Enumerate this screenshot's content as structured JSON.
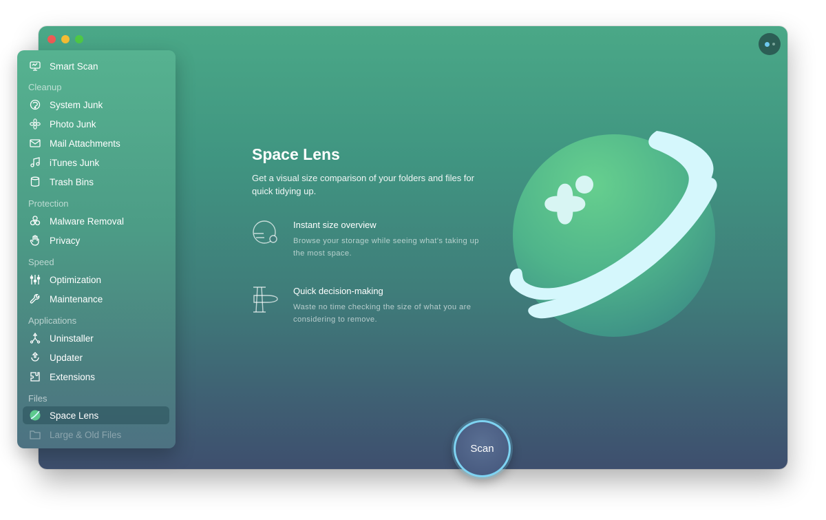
{
  "sidebar": {
    "smart_scan": "Smart Scan",
    "sections": {
      "cleanup": "Cleanup",
      "protection": "Protection",
      "speed": "Speed",
      "applications": "Applications",
      "files": "Files"
    },
    "items": {
      "system_junk": "System Junk",
      "photo_junk": "Photo Junk",
      "mail_attachments": "Mail Attachments",
      "itunes_junk": "iTunes Junk",
      "trash_bins": "Trash Bins",
      "malware_removal": "Malware Removal",
      "privacy": "Privacy",
      "optimization": "Optimization",
      "maintenance": "Maintenance",
      "uninstaller": "Uninstaller",
      "updater": "Updater",
      "extensions": "Extensions",
      "space_lens": "Space Lens",
      "large_old_files": "Large & Old Files"
    },
    "selected": "Space Lens"
  },
  "main": {
    "title": "Space Lens",
    "description": "Get a visual size comparison of your folders and files for quick tidying up.",
    "features": [
      {
        "icon": "size-overview-icon",
        "title": "Instant size overview",
        "description": "Browse your storage while seeing what's taking up the most space."
      },
      {
        "icon": "decision-icon",
        "title": "Quick decision-making",
        "description": "Waste no time checking the size of what you are considering to remove."
      }
    ]
  },
  "scan_button": {
    "label": "Scan"
  },
  "colors": {
    "accent_ring": "#7ed3f2",
    "window_top": "#4aa887",
    "window_bottom": "#3e4f6e"
  }
}
